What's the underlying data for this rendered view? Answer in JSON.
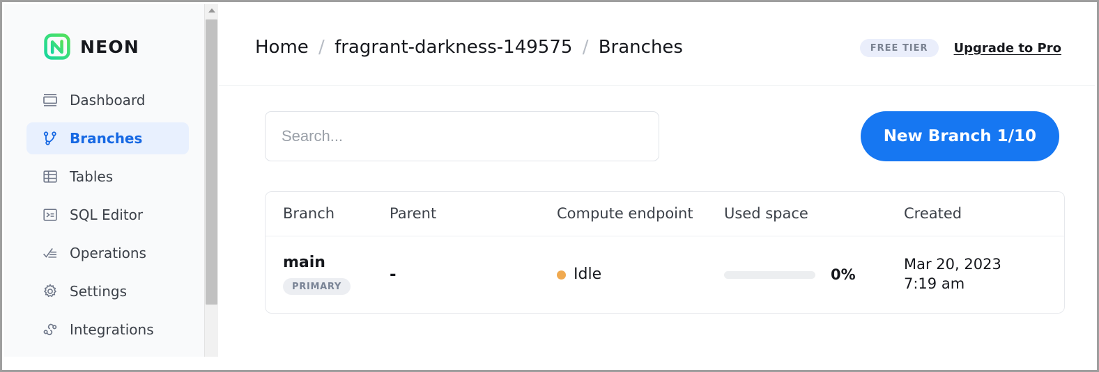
{
  "brand": {
    "name": "NEON",
    "logo_icon": "neon-logo-icon",
    "logo_gradient_start": "#1fd3a0",
    "logo_gradient_end": "#4ade5b"
  },
  "sidebar": {
    "items": [
      {
        "label": "Dashboard",
        "icon": "dashboard-icon",
        "active": false
      },
      {
        "label": "Branches",
        "icon": "branch-icon",
        "active": true
      },
      {
        "label": "Tables",
        "icon": "table-icon",
        "active": false
      },
      {
        "label": "SQL Editor",
        "icon": "sql-terminal-icon",
        "active": false
      },
      {
        "label": "Operations",
        "icon": "operations-icon",
        "active": false
      },
      {
        "label": "Settings",
        "icon": "gear-icon",
        "active": false
      },
      {
        "label": "Integrations",
        "icon": "integrations-icon",
        "active": false
      }
    ],
    "active_bg": "#e8f0fe",
    "active_color": "#1668e3"
  },
  "scrollbar": {
    "up_arrow_icon": "scroll-up-arrow-icon",
    "thumb_color": "#c1c1c1",
    "track_color": "#f1f1f1"
  },
  "header": {
    "breadcrumb": {
      "home": "Home",
      "project": "fragrant-darkness-149575",
      "current": "Branches",
      "separator": "/"
    },
    "tier_badge": "FREE TIER",
    "upgrade_link": "Upgrade to Pro"
  },
  "toolbar": {
    "search_value": "",
    "search_placeholder": "Search...",
    "new_branch_label": "New Branch 1/10",
    "new_branch_color": "#1677f2"
  },
  "table": {
    "columns": [
      "Branch",
      "Parent",
      "Compute endpoint",
      "Used space",
      "Created"
    ],
    "rows": [
      {
        "branch": "main",
        "badge": "PRIMARY",
        "parent": "-",
        "compute_status": "Idle",
        "compute_status_color": "#f0a94f",
        "used_space_pct_label": "0%",
        "used_space_pct_value": 0,
        "created_date": "Mar 20, 2023",
        "created_time": "7:19 am"
      }
    ]
  }
}
